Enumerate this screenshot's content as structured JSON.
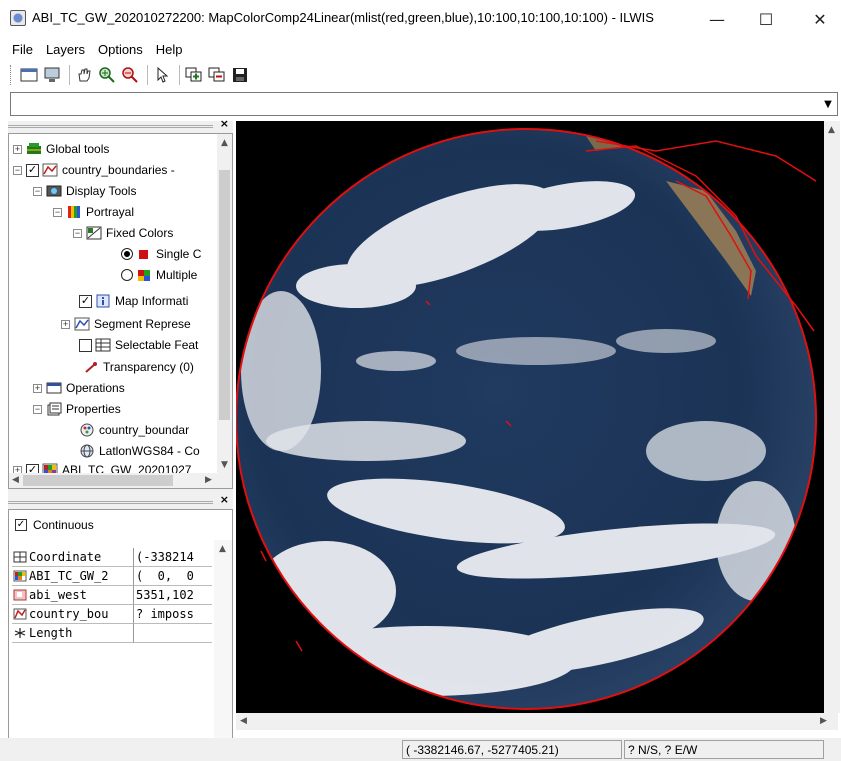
{
  "window": {
    "title": "ABI_TC_GW_202010272200: MapColorComp24Linear(mlist(red,green,blue),10:100,10:100,10:100) - ILWIS",
    "minimize": "—",
    "maximize": "☐",
    "close": "✕"
  },
  "menu": [
    "File",
    "Layers",
    "Options",
    "Help"
  ],
  "toolbar": {
    "icons": [
      "new-map-window-icon",
      "display-icon",
      "pan-hand-icon",
      "zoom-in-icon",
      "zoom-out-icon",
      "select-pointer-icon",
      "add-layer-icon",
      "remove-layer-icon",
      "save-icon"
    ]
  },
  "command_line": {
    "value": ""
  },
  "tree": {
    "items": [
      {
        "label": "Global tools",
        "icon": "global-tools-icon"
      },
      {
        "label": "country_boundaries -",
        "icon": "segment-map-icon"
      },
      {
        "label": "Display Tools",
        "icon": "display-tools-icon"
      },
      {
        "label": "Portrayal",
        "icon": "portrayal-icon"
      },
      {
        "label": "Fixed Colors",
        "icon": "fixed-colors-icon"
      },
      {
        "label": "Single C",
        "icon": "single-color-icon"
      },
      {
        "label": "Multiple",
        "icon": "multiple-colors-icon"
      },
      {
        "label": "Map Informati",
        "icon": "info-icon"
      },
      {
        "label": "Segment Represe",
        "icon": "segment-rep-icon"
      },
      {
        "label": "Selectable Feat",
        "icon": "table-icon"
      },
      {
        "label": "Transparency (0)",
        "icon": "transparency-icon"
      },
      {
        "label": "Operations",
        "icon": "operations-icon"
      },
      {
        "label": "Properties",
        "icon": "properties-icon"
      },
      {
        "label": "country_boundar",
        "icon": "domain-icon"
      },
      {
        "label": "LatlonWGS84 - Co",
        "icon": "globe-icon"
      },
      {
        "label": "ABI_TC_GW_20201027",
        "icon": "raster-icon"
      }
    ]
  },
  "pixel_info": {
    "continuous_label": "Continuous",
    "continuous_checked": true,
    "rows": [
      {
        "name": "Coordinate",
        "value": "(-338214",
        "icon": "coordinate-icon"
      },
      {
        "name": "ABI_TC_GW_2",
        "value": "(  0,  0",
        "icon": "raster-icon"
      },
      {
        "name": "abi_west",
        "value": "5351,102",
        "icon": "georef-icon"
      },
      {
        "name": "country_bou",
        "value": "? imposs",
        "icon": "segment-map-icon"
      },
      {
        "name": "Length",
        "value": "",
        "icon": "length-icon"
      }
    ]
  },
  "status": {
    "coordinates": "( -3382146.67, -5277405.21)",
    "latlon": "? N/S, ? E/W"
  },
  "colors": {
    "map_background": "#000000",
    "boundary": "#e01010",
    "ocean": "#1b3355"
  }
}
